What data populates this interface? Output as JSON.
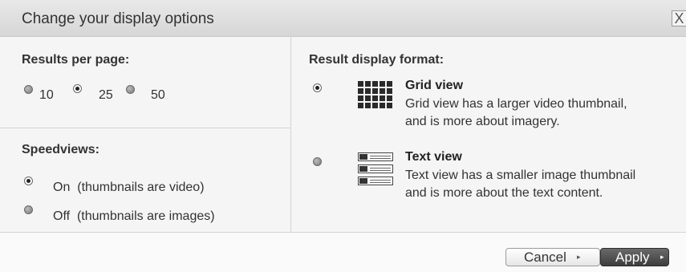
{
  "dialog": {
    "title": "Change your display options",
    "close_label": "X"
  },
  "results_per_page": {
    "label": "Results per page:",
    "options": [
      {
        "label": "10",
        "selected": false
      },
      {
        "label": "25",
        "selected": true
      },
      {
        "label": "50",
        "selected": false
      }
    ]
  },
  "speedviews": {
    "label": "Speedviews:",
    "options": [
      {
        "label": "On  (thumbnails are video)",
        "selected": true
      },
      {
        "label": "Off  (thumbnails are images)",
        "selected": false
      }
    ]
  },
  "display_format": {
    "label": "Result display format:",
    "options": [
      {
        "title": "Grid view",
        "description_line1": "Grid view has a larger video thumbnail,",
        "description_line2": "and is more about imagery.",
        "icon": "grid-view-icon",
        "selected": true
      },
      {
        "title": "Text view",
        "description_line1": "Text view has a smaller image thumbnail",
        "description_line2": "and is more about the text content.",
        "icon": "text-view-icon",
        "selected": false
      }
    ]
  },
  "footer": {
    "cancel_label": "Cancel",
    "apply_label": "Apply",
    "arrow_glyph": "▸"
  }
}
